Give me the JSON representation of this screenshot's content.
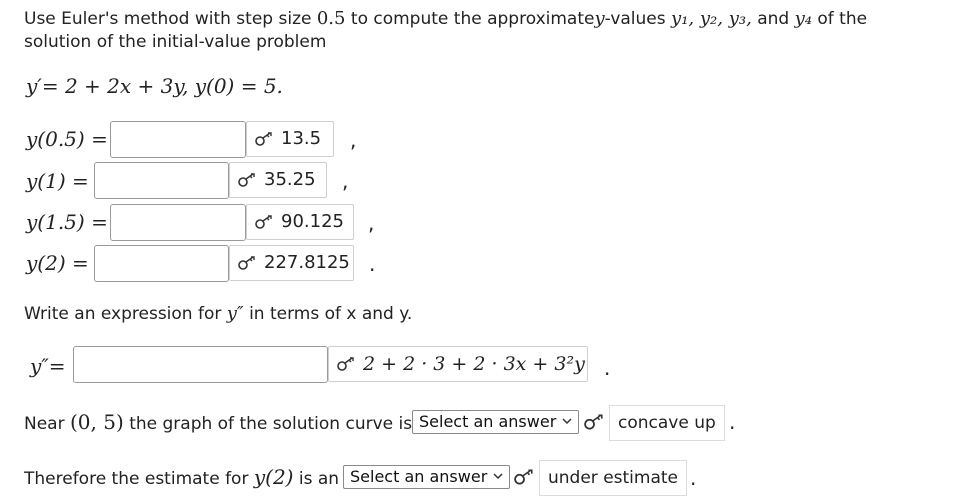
{
  "problem": {
    "intro_line1_a": "Use Euler's method with step size",
    "step": "0.5",
    "intro_line1_b": "to compute the approximate",
    "yvar": "y",
    "intro_line1_c": "-values",
    "y1": "y₁, y₂, y₃,",
    "and": "and",
    "y4": "y₄",
    "ofthe": "of the",
    "intro_line2": "solution of the initial-value problem",
    "equation": "y′= 2 + 2x + 3y,   y(0) = 5."
  },
  "rows": [
    {
      "label": "y(0.5) =",
      "answer": "13.5",
      "punct": ","
    },
    {
      "label": "y(1) =",
      "answer": "35.25",
      "punct": ","
    },
    {
      "label": "y(1.5) =",
      "answer": "90.125",
      "punct": ","
    },
    {
      "label": "y(2) =",
      "answer": "227.8125",
      "punct": "."
    }
  ],
  "second": {
    "prompt_a": "Write an expression for",
    "prompt_math": "y″",
    "prompt_b": "in terms of x and y.",
    "label": "y″=",
    "answer": "2 + 2 · 3 + 2 · 3x + 3²y",
    "punct": "."
  },
  "near": {
    "text_a": "Near",
    "point": "(0, 5)",
    "text_b": "the graph of the solution curve is",
    "select": "Select an answer",
    "answer": "concave up",
    "punct": "."
  },
  "therefore": {
    "text_a": "Therefore the estimate for",
    "math": "y(2)",
    "text_b": "is an",
    "select": "Select an answer",
    "answer": "under estimate",
    "punct": "."
  },
  "icons": {
    "key": "key-icon",
    "chevron": "chevron-down-icon"
  }
}
